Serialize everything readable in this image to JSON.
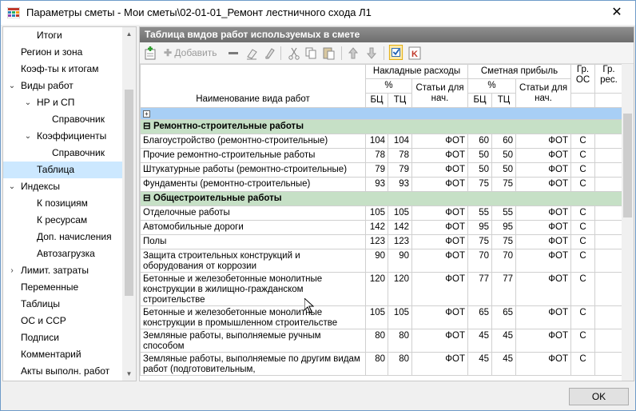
{
  "window": {
    "title": "Параметры сметы - Мои сметы\\02-01-01_Ремонт лестничного схода Л1",
    "close_glyph": "✕"
  },
  "sidebar": {
    "items": [
      {
        "label": "Итоги",
        "indent": 2,
        "chevron": "",
        "selected": false
      },
      {
        "label": "Регион и зона",
        "indent": 1,
        "chevron": "",
        "selected": false
      },
      {
        "label": "Коэф-ты к итогам",
        "indent": 1,
        "chevron": "",
        "selected": false
      },
      {
        "label": "Виды работ",
        "indent": 1,
        "chevron": "⌄",
        "selected": false
      },
      {
        "label": "НР и СП",
        "indent": 2,
        "chevron": "⌄",
        "selected": false
      },
      {
        "label": "Справочник",
        "indent": 3,
        "chevron": "",
        "selected": false
      },
      {
        "label": "Коэффициенты",
        "indent": 2,
        "chevron": "⌄",
        "selected": false
      },
      {
        "label": "Справочник",
        "indent": 3,
        "chevron": "",
        "selected": false
      },
      {
        "label": "Таблица",
        "indent": 2,
        "chevron": "",
        "selected": true
      },
      {
        "label": "Индексы",
        "indent": 1,
        "chevron": "⌄",
        "selected": false
      },
      {
        "label": "К позициям",
        "indent": 2,
        "chevron": "",
        "selected": false
      },
      {
        "label": "К ресурсам",
        "indent": 2,
        "chevron": "",
        "selected": false
      },
      {
        "label": "Доп. начисления",
        "indent": 2,
        "chevron": "",
        "selected": false
      },
      {
        "label": "Автозагрузка",
        "indent": 2,
        "chevron": "",
        "selected": false
      },
      {
        "label": "Лимит. затраты",
        "indent": 1,
        "chevron": "›",
        "selected": false
      },
      {
        "label": "Переменные",
        "indent": 1,
        "chevron": "",
        "selected": false
      },
      {
        "label": "Таблицы",
        "indent": 1,
        "chevron": "",
        "selected": false
      },
      {
        "label": "ОС и ССР",
        "indent": 1,
        "chevron": "",
        "selected": false
      },
      {
        "label": "Подписи",
        "indent": 1,
        "chevron": "",
        "selected": false
      },
      {
        "label": "Комментарий",
        "indent": 1,
        "chevron": "",
        "selected": false
      },
      {
        "label": "Акты выполн. работ",
        "indent": 1,
        "chevron": "",
        "selected": false
      }
    ]
  },
  "main": {
    "title": "Таблица вмдов работ используемых в смете",
    "toolbar": {
      "add_label": "Добавить"
    },
    "headers": {
      "name": "Наименование вида работ",
      "overhead": "Накладные расходы",
      "profit": "Сметная прибыль",
      "gr_os": "Гр. ОС",
      "gr_res": "Гр. рес.",
      "percent": "%",
      "articles": "Статьи для нач.",
      "bc": "БЦ",
      "tc": "ТЦ"
    },
    "expand_glyph": "+",
    "groups": [
      {
        "title": "Ремонтно-строительные работы",
        "rows": [
          {
            "name": "Благоустройство (ремонтно-строительные)",
            "nr_bc": "104",
            "nr_tc": "104",
            "nr_art": "ФОТ",
            "sp_bc": "60",
            "sp_tc": "60",
            "sp_art": "ФОТ",
            "gr_os": "С",
            "gr_res": ""
          },
          {
            "name": "Прочие ремонтно-строительные работы",
            "nr_bc": "78",
            "nr_tc": "78",
            "nr_art": "ФОТ",
            "sp_bc": "50",
            "sp_tc": "50",
            "sp_art": "ФОТ",
            "gr_os": "С",
            "gr_res": ""
          },
          {
            "name": "Штукатурные работы (ремонтно-строительные)",
            "nr_bc": "79",
            "nr_tc": "79",
            "nr_art": "ФОТ",
            "sp_bc": "50",
            "sp_tc": "50",
            "sp_art": "ФОТ",
            "gr_os": "С",
            "gr_res": ""
          },
          {
            "name": "Фундаменты (ремонтно-строительные)",
            "nr_bc": "93",
            "nr_tc": "93",
            "nr_art": "ФОТ",
            "sp_bc": "75",
            "sp_tc": "75",
            "sp_art": "ФОТ",
            "gr_os": "С",
            "gr_res": ""
          }
        ]
      },
      {
        "title": "Общестроительные работы",
        "rows": [
          {
            "name": "Отделочные работы",
            "nr_bc": "105",
            "nr_tc": "105",
            "nr_art": "ФОТ",
            "sp_bc": "55",
            "sp_tc": "55",
            "sp_art": "ФОТ",
            "gr_os": "С",
            "gr_res": ""
          },
          {
            "name": "Автомобильные дороги",
            "nr_bc": "142",
            "nr_tc": "142",
            "nr_art": "ФОТ",
            "sp_bc": "95",
            "sp_tc": "95",
            "sp_art": "ФОТ",
            "gr_os": "С",
            "gr_res": ""
          },
          {
            "name": "Полы",
            "nr_bc": "123",
            "nr_tc": "123",
            "nr_art": "ФОТ",
            "sp_bc": "75",
            "sp_tc": "75",
            "sp_art": "ФОТ",
            "gr_os": "С",
            "gr_res": ""
          },
          {
            "name": "Защита строительных конструкций и оборудования от коррозии",
            "nr_bc": "90",
            "nr_tc": "90",
            "nr_art": "ФОТ",
            "sp_bc": "70",
            "sp_tc": "70",
            "sp_art": "ФОТ",
            "gr_os": "С",
            "gr_res": ""
          },
          {
            "name": "Бетонные и железобетонные монолитные конструкции в жилищно-гражданском строительстве",
            "nr_bc": "120",
            "nr_tc": "120",
            "nr_art": "ФОТ",
            "sp_bc": "77",
            "sp_tc": "77",
            "sp_art": "ФОТ",
            "gr_os": "С",
            "gr_res": ""
          },
          {
            "name": "Бетонные и железобетонные монолитные конструкции в промышленном строительстве",
            "nr_bc": "105",
            "nr_tc": "105",
            "nr_art": "ФОТ",
            "sp_bc": "65",
            "sp_tc": "65",
            "sp_art": "ФОТ",
            "gr_os": "С",
            "gr_res": ""
          },
          {
            "name": "Земляные работы, выполняемые ручным способом",
            "nr_bc": "80",
            "nr_tc": "80",
            "nr_art": "ФОТ",
            "sp_bc": "45",
            "sp_tc": "45",
            "sp_art": "ФОТ",
            "gr_os": "С",
            "gr_res": ""
          },
          {
            "name": "Земляные работы, выполняемые по другим видам работ (подготовительным,",
            "nr_bc": "80",
            "nr_tc": "80",
            "nr_art": "ФОТ",
            "sp_bc": "45",
            "sp_tc": "45",
            "sp_art": "ФОТ",
            "gr_os": "С",
            "gr_res": ""
          }
        ]
      }
    ]
  },
  "footer": {
    "ok_label": "OK"
  }
}
